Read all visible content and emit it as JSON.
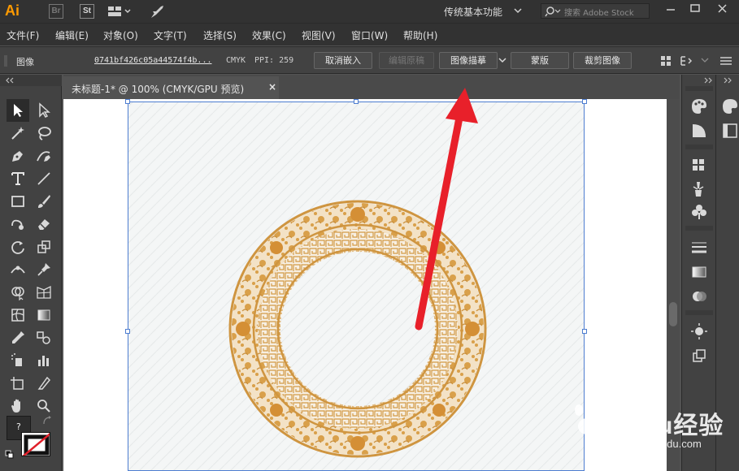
{
  "app": {
    "logo_text": "Ai",
    "bridge_label": "Br",
    "stock_label": "St",
    "workspace": "传统基本功能",
    "search_placeholder": "搜索 Adobe Stock"
  },
  "menu": {
    "items": [
      "文件(F)",
      "编辑(E)",
      "对象(O)",
      "文字(T)",
      "选择(S)",
      "效果(C)",
      "视图(V)",
      "窗口(W)",
      "帮助(H)"
    ]
  },
  "control_bar": {
    "object_type": "图像",
    "file_link": "0741bf426c05a44574f4b...",
    "color_mode": "CMYK",
    "ppi": "PPI: 259",
    "unembed": "取消嵌入",
    "edit_original": "编辑原稿",
    "image_trace": "图像描摹",
    "mask": "蒙版",
    "crop": "裁剪图像"
  },
  "document": {
    "tab_title": "未标题-1* @ 100% (CMYK/GPU 预览)",
    "close": "×"
  },
  "toolbar": {
    "color_swatch_label": "?"
  },
  "colors": {
    "accent_orange": "#ff9a00",
    "ornament": "#d9a04a",
    "arrow_red": "#e8202a",
    "selection_blue": "#4d7dd0"
  },
  "watermark": {
    "brand": "Baidu经验",
    "url": "jingyan.baidu.com"
  }
}
